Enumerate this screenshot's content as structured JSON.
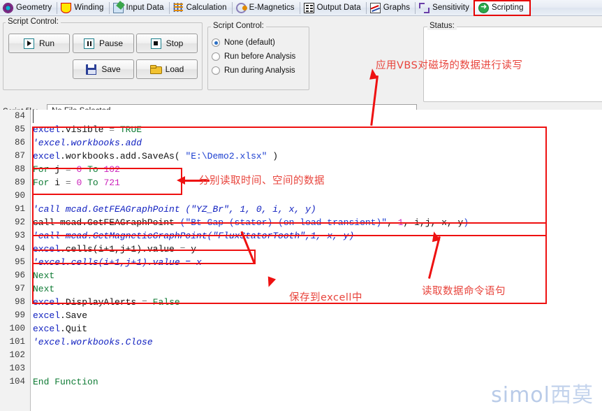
{
  "tabs": [
    {
      "label": "Geometry",
      "icon": "geometry-icon",
      "active": false
    },
    {
      "label": "Winding",
      "icon": "winding-icon",
      "active": false
    },
    {
      "label": "Input Data",
      "icon": "input-data-icon",
      "active": false
    },
    {
      "label": "Calculation",
      "icon": "calculation-icon",
      "active": false
    },
    {
      "label": "E-Magnetics",
      "icon": "emagnetics-icon",
      "active": false
    },
    {
      "label": "Output Data",
      "icon": "output-data-icon",
      "active": false
    },
    {
      "label": "Graphs",
      "icon": "graphs-icon",
      "active": false
    },
    {
      "label": "Sensitivity",
      "icon": "sensitivity-icon",
      "active": false
    },
    {
      "label": "Scripting",
      "icon": "scripting-icon",
      "active": true
    }
  ],
  "panel": {
    "group_label": "Script Control:",
    "buttons": [
      {
        "label": "Run",
        "icon": "play-icon"
      },
      {
        "label": "Pause",
        "icon": "pause-icon"
      },
      {
        "label": "Stop",
        "icon": "stop-icon"
      },
      {
        "label": "Save",
        "icon": "floppy-disk-icon"
      },
      {
        "label": "Load",
        "icon": "folder-open-icon"
      }
    ],
    "radio_group_label": "Script Control:",
    "radios": [
      {
        "label": "None (default)",
        "selected": true
      },
      {
        "label": "Run before Analysis",
        "selected": false
      },
      {
        "label": "Run during Analysis",
        "selected": false
      }
    ],
    "script_file_label": "Script file:",
    "script_file_value": "No File Selected",
    "status_label": "Status:",
    "status_value": ""
  },
  "code": {
    "first_line_number": 84,
    "lines": [
      {
        "n": 84,
        "tokens": [
          {
            "t": "",
            "c": "pl"
          }
        ]
      },
      {
        "n": 85,
        "tokens": [
          {
            "t": "excel",
            "c": "id"
          },
          {
            "t": ".visible ",
            "c": "pl"
          },
          {
            "t": "=",
            "c": "op"
          },
          {
            "t": " ",
            "c": "pl"
          },
          {
            "t": "TRUE",
            "c": "k"
          }
        ]
      },
      {
        "n": 86,
        "tokens": [
          {
            "t": "'excel.workbooks.add",
            "c": "cm"
          }
        ]
      },
      {
        "n": 87,
        "tokens": [
          {
            "t": "excel",
            "c": "id"
          },
          {
            "t": ".workbooks.add.SaveAs",
            "c": "pl"
          },
          {
            "t": "( ",
            "c": "pl"
          },
          {
            "t": "\"E:\\Demo2.xlsx\"",
            "c": "str"
          },
          {
            "t": " )",
            "c": "pl"
          }
        ]
      },
      {
        "n": 88,
        "tokens": [
          {
            "t": "For",
            "c": "k"
          },
          {
            "t": " j ",
            "c": "pl"
          },
          {
            "t": "=",
            "c": "op"
          },
          {
            "t": " ",
            "c": "pl"
          },
          {
            "t": "0",
            "c": "num"
          },
          {
            "t": " ",
            "c": "pl"
          },
          {
            "t": "To",
            "c": "k"
          },
          {
            "t": " ",
            "c": "pl"
          },
          {
            "t": "102",
            "c": "num"
          }
        ]
      },
      {
        "n": 89,
        "tokens": [
          {
            "t": "For",
            "c": "k"
          },
          {
            "t": " i ",
            "c": "pl"
          },
          {
            "t": "=",
            "c": "op"
          },
          {
            "t": " ",
            "c": "pl"
          },
          {
            "t": "0",
            "c": "num"
          },
          {
            "t": " ",
            "c": "pl"
          },
          {
            "t": "To",
            "c": "k"
          },
          {
            "t": " ",
            "c": "pl"
          },
          {
            "t": "721",
            "c": "num"
          }
        ]
      },
      {
        "n": 90,
        "tokens": [
          {
            "t": "",
            "c": "pl"
          }
        ]
      },
      {
        "n": 91,
        "tokens": [
          {
            "t": "'call mcad.GetFEAGraphPoint (\"YZ_Br\", 1, 0, i, x, y)",
            "c": "cm"
          }
        ]
      },
      {
        "n": 92,
        "tokens": [
          {
            "t": "call mcad.GetFEAGraphPoint ",
            "c": "pl"
          },
          {
            "t": "(\"Bt Gap (stator) (on load transient)\"",
            "c": "str"
          },
          {
            "t": ", ",
            "c": "pl"
          },
          {
            "t": "1",
            "c": "num"
          },
          {
            "t": ", i,j, x, y",
            "c": "pl"
          },
          {
            "t": ")",
            "c": "str"
          }
        ]
      },
      {
        "n": 93,
        "tokens": [
          {
            "t": "'call mcad.GetMagneticGraphPoint(\"FluxStatorTooth\",1, x, y)",
            "c": "cm"
          }
        ]
      },
      {
        "n": 94,
        "tokens": [
          {
            "t": "excel",
            "c": "id"
          },
          {
            "t": ".cells(i+1,j+1).value ",
            "c": "pl"
          },
          {
            "t": "=",
            "c": "op"
          },
          {
            "t": " y",
            "c": "pl"
          }
        ]
      },
      {
        "n": 95,
        "tokens": [
          {
            "t": "'excel.cells(i+1,j+1).value = x",
            "c": "cm"
          }
        ]
      },
      {
        "n": 96,
        "tokens": [
          {
            "t": "Next",
            "c": "k"
          }
        ]
      },
      {
        "n": 97,
        "tokens": [
          {
            "t": "Next",
            "c": "k"
          }
        ]
      },
      {
        "n": 98,
        "tokens": [
          {
            "t": "excel",
            "c": "id"
          },
          {
            "t": ".DisplayAlerts ",
            "c": "pl"
          },
          {
            "t": "=",
            "c": "op"
          },
          {
            "t": " ",
            "c": "pl"
          },
          {
            "t": "False",
            "c": "k"
          }
        ]
      },
      {
        "n": 99,
        "tokens": [
          {
            "t": "excel",
            "c": "id"
          },
          {
            "t": ".Save",
            "c": "pl"
          }
        ]
      },
      {
        "n": 100,
        "tokens": [
          {
            "t": "excel",
            "c": "id"
          },
          {
            "t": ".Quit",
            "c": "pl"
          }
        ]
      },
      {
        "n": 101,
        "tokens": [
          {
            "t": "'excel.workbooks.Close",
            "c": "cm"
          }
        ]
      },
      {
        "n": 102,
        "tokens": [
          {
            "t": "",
            "c": "pl"
          }
        ]
      },
      {
        "n": 103,
        "tokens": [
          {
            "t": "",
            "c": "pl"
          }
        ]
      },
      {
        "n": 104,
        "tokens": [
          {
            "t": "End Function",
            "c": "k"
          }
        ]
      }
    ]
  },
  "annotations": [
    {
      "id": "note-vbs",
      "text": "应用VBS对磁场的数据进行读写"
    },
    {
      "id": "note-loops",
      "text": "分别读取时间、空间的数据"
    },
    {
      "id": "note-saveexcel",
      "text": "保存到excell中"
    },
    {
      "id": "note-readcmd",
      "text": "读取数据命令语句"
    }
  ],
  "watermark": {
    "latin": "simol",
    "cjk": "西莫"
  },
  "colors": {
    "annotation_red": "#ee1111",
    "annotation_text": "#e8443c",
    "tab_active_border": "#e60000",
    "watermark": "#b9cbe8"
  }
}
